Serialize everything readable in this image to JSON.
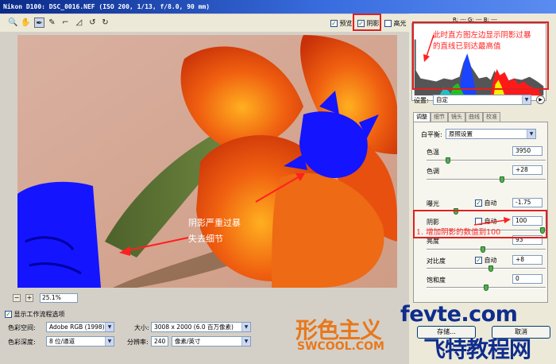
{
  "window": {
    "title": "Nikon D100:  DSC_0016.NEF  (ISO 200, 1/13, f/8.0, 90 mm)"
  },
  "toolbar": {
    "tools": [
      {
        "name": "zoom-tool-icon",
        "glyph": "🔍"
      },
      {
        "name": "hand-tool-icon",
        "glyph": "✋"
      },
      {
        "name": "eyedropper-tool-icon",
        "glyph": "✒"
      },
      {
        "name": "color-sampler-icon",
        "glyph": "✎"
      },
      {
        "name": "crop-tool-icon",
        "glyph": "⌐"
      },
      {
        "name": "straighten-tool-icon",
        "glyph": "◿"
      },
      {
        "name": "rotate-left-icon",
        "glyph": "↺"
      },
      {
        "name": "rotate-right-icon",
        "glyph": "↻"
      }
    ],
    "preview_label": "预览",
    "shadows_label": "阴影",
    "highlights_label": "高光"
  },
  "colors": {
    "clip_blue": "#1414ff",
    "annot_red": "#ff2020",
    "accent_green": "#4fb050"
  },
  "zoom": {
    "value": "25.1%"
  },
  "workflow": {
    "title": "显示工作流程选项",
    "colorspace_label": "色彩空间:",
    "colorspace": "Adobe RGB (1998)",
    "depth_label": "色彩深度:",
    "depth": "8 位/通道",
    "size_label": "大小:",
    "size": "3008 x 2000  (6.0 百万像素)",
    "res_label": "分辨率:",
    "res": "240",
    "res_unit": "像素/英寸"
  },
  "sidebar": {
    "rgb_readout": "R: ---  G: ---  B: ---",
    "settings_label": "设置:",
    "settings_value": "自定",
    "tabs": [
      "调整",
      "细节",
      "镜头",
      "曲线",
      "校准"
    ],
    "wb_label": "白平衡:",
    "wb_value": "原照设置",
    "temp_label": "色温",
    "temp_value": "3950",
    "tint_label": "色调",
    "tint_value": "+28",
    "exposure_label": "曝光",
    "exposure_value": "-1.75",
    "shadows_label": "阴影",
    "shadows_value": "100",
    "brightness_label": "亮度",
    "brightness_value": "93",
    "contrast_label": "对比度",
    "contrast_value": "+8",
    "saturation_label": "饱和度",
    "saturation_value": "0",
    "auto_label": "自动",
    "open_button": "存储...",
    "cancel_button": "取消"
  },
  "annotations": {
    "histogram_line1": "此时直方图左边显示阴影过暴",
    "histogram_line2": "的直线已到达最高值",
    "shadow_note": "1. 增加阴影的数值到100",
    "image_line1": "阴影严重过暴",
    "image_line2": "失去细节"
  },
  "logo": {
    "cn": "形色主义",
    "en": "SWCOOL.COM"
  },
  "watermark": {
    "line1": "fevte.com",
    "line2": "飞特教程网"
  }
}
